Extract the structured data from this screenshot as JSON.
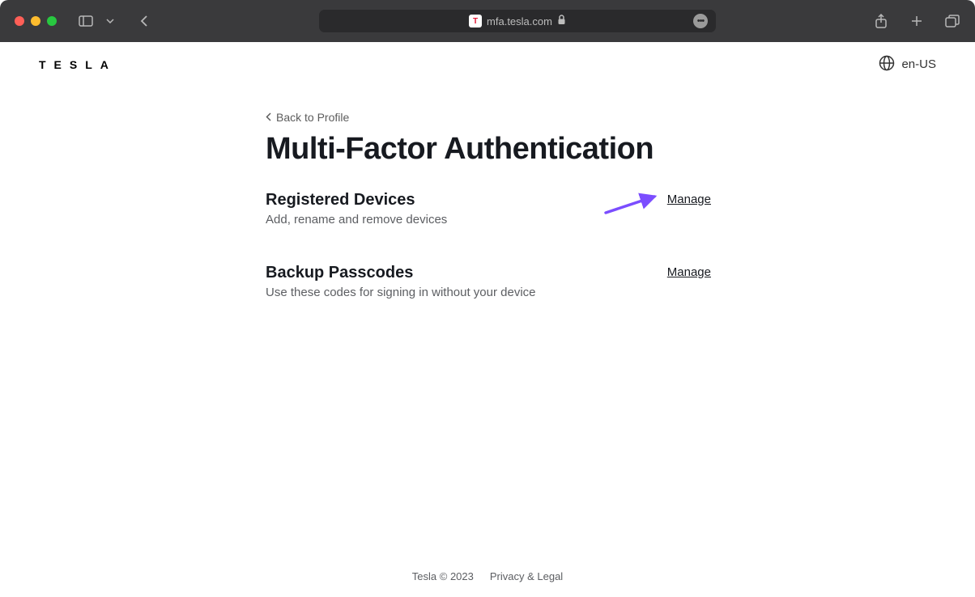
{
  "browser": {
    "url": "mfa.tesla.com"
  },
  "header": {
    "logo": "TESLA",
    "lang": "en-US"
  },
  "nav": {
    "back_label": "Back to Profile"
  },
  "page": {
    "title": "Multi-Factor Authentication"
  },
  "sections": [
    {
      "title": "Registered Devices",
      "desc": "Add, rename and remove devices",
      "action": "Manage"
    },
    {
      "title": "Backup Passcodes",
      "desc": "Use these codes for signing in without your device",
      "action": "Manage"
    }
  ],
  "footer": {
    "copyright": "Tesla © 2023",
    "legal": "Privacy & Legal"
  },
  "annotation": {
    "arrow_color": "#7b4dff"
  }
}
